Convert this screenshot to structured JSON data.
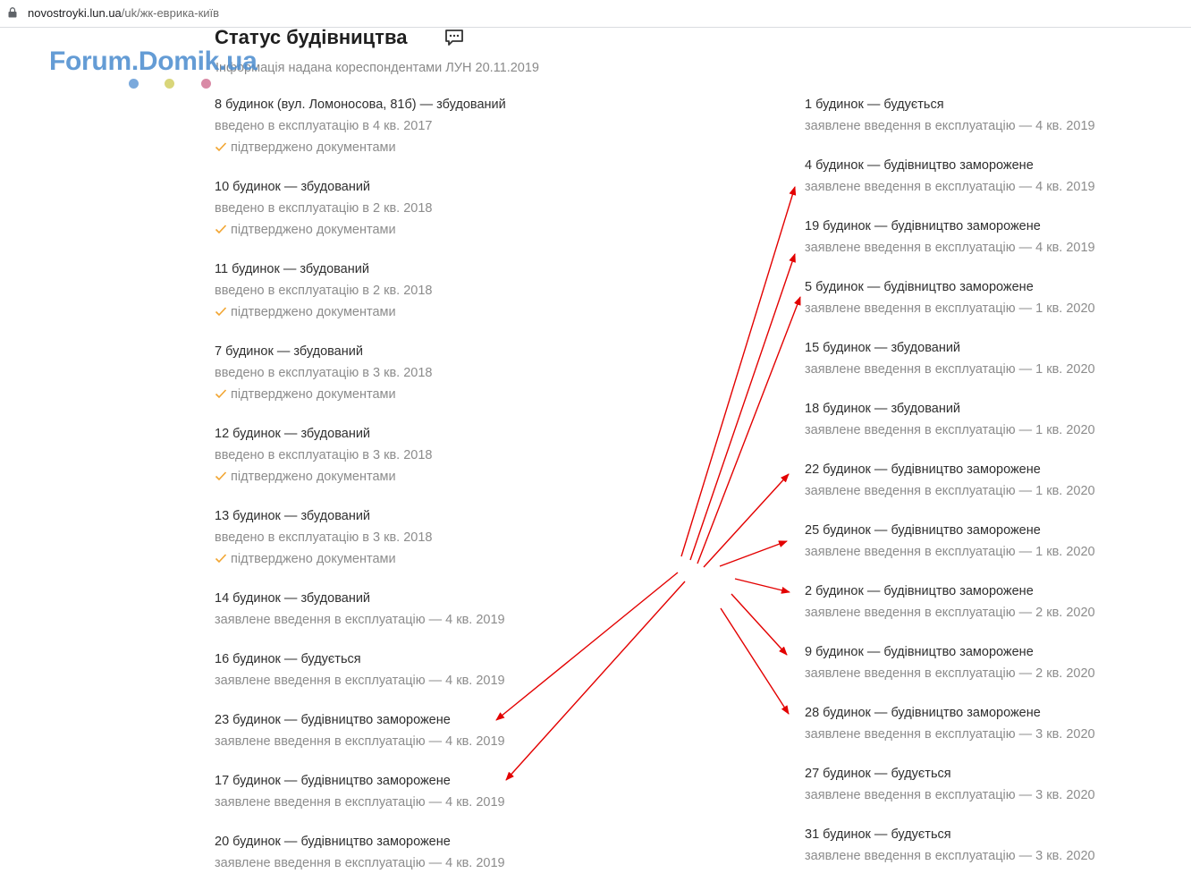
{
  "browser": {
    "url_host": "novostroyki.lun.ua",
    "url_path": "/uk/жк-еврика-київ"
  },
  "page": {
    "title": "Статус будівництва",
    "subtitle": "Інформація надана кореспондентами ЛУН 20.11.2019"
  },
  "watermark": {
    "text": "Forum.Domik.ua",
    "dot_colors": [
      "#7aa9dc",
      "#d9d67a",
      "#d98aa6"
    ]
  },
  "colors": {
    "check": "#f2a531",
    "arrow": "#e30000"
  },
  "left_column": [
    {
      "title": "8 будинок (вул. Ломоносова, 81б) — збудований",
      "sub": "введено в експлуатацію в 4 кв. 2017",
      "confirmed": "підтверджено документами"
    },
    {
      "title": "10 будинок — збудований",
      "sub": "введено в експлуатацію в 2 кв. 2018",
      "confirmed": "підтверджено документами"
    },
    {
      "title": "11 будинок — збудований",
      "sub": "введено в експлуатацію в 2 кв. 2018",
      "confirmed": "підтверджено документами"
    },
    {
      "title": "7 будинок — збудований",
      "sub": "введено в експлуатацію в 3 кв. 2018",
      "confirmed": "підтверджено документами"
    },
    {
      "title": "12 будинок — збудований",
      "sub": "введено в експлуатацію в 3 кв. 2018",
      "confirmed": "підтверджено документами"
    },
    {
      "title": "13 будинок — збудований",
      "sub": "введено в експлуатацію в 3 кв. 2018",
      "confirmed": "підтверджено документами"
    },
    {
      "title": "14 будинок — збудований",
      "sub": "заявлене введення в експлуатацію — 4 кв. 2019"
    },
    {
      "title": "16 будинок — будується",
      "sub": "заявлене введення в експлуатацію — 4 кв. 2019"
    },
    {
      "title": "23 будинок — будівництво заморожене",
      "sub": "заявлене введення в експлуатацію — 4 кв. 2019"
    },
    {
      "title": "17 будинок — будівництво заморожене",
      "sub": "заявлене введення в експлуатацію — 4 кв. 2019"
    },
    {
      "title": "20 будинок — будівництво заморожене",
      "sub": "заявлене введення в експлуатацію — 4 кв. 2019"
    }
  ],
  "right_column": [
    {
      "title": "1 будинок — будується",
      "sub": "заявлене введення в експлуатацію — 4 кв. 2019"
    },
    {
      "title": "4 будинок — будівництво заморожене",
      "sub": "заявлене введення в експлуатацію — 4 кв. 2019"
    },
    {
      "title": "19 будинок — будівництво заморожене",
      "sub": "заявлене введення в експлуатацію — 4 кв. 2019"
    },
    {
      "title": "5 будинок — будівництво заморожене",
      "sub": "заявлене введення в експлуатацію — 1 кв. 2020"
    },
    {
      "title": "15 будинок — збудований",
      "sub": "заявлене введення в експлуатацію — 1 кв. 2020"
    },
    {
      "title": "18 будинок — збудований",
      "sub": "заявлене введення в експлуатацію — 1 кв. 2020"
    },
    {
      "title": "22 будинок — будівництво заморожене",
      "sub": "заявлене введення в експлуатацію — 1 кв. 2020"
    },
    {
      "title": "25 будинок — будівництво заморожене",
      "sub": "заявлене введення в експлуатацію — 1 кв. 2020"
    },
    {
      "title": "2 будинок — будівництво заморожене",
      "sub": "заявлене введення в експлуатацію — 2 кв. 2020"
    },
    {
      "title": "9 будинок — будівництво заморожене",
      "sub": "заявлене введення в експлуатацію — 2 кв. 2020"
    },
    {
      "title": "28 будинок — будівництво заморожене",
      "sub": "заявлене введення в експлуатацію — 3 кв. 2020"
    },
    {
      "title": "27 будинок — будується",
      "sub": "заявлене введення в експлуатацію — 3 кв. 2020"
    },
    {
      "title": "31 будинок — будується",
      "sub": "заявлене введення в експлуатацію — 3 кв. 2020"
    }
  ]
}
